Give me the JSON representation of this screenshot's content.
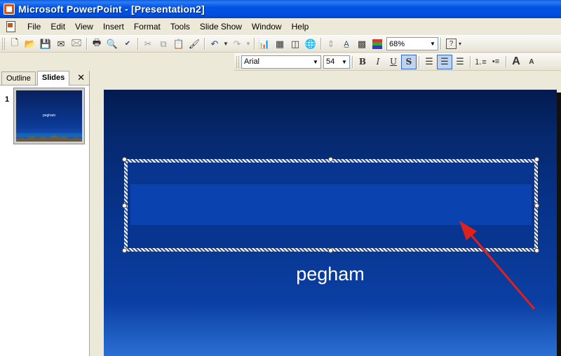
{
  "window": {
    "title": "Microsoft PowerPoint - [Presentation2]"
  },
  "menu": {
    "items": [
      {
        "label": "File"
      },
      {
        "label": "Edit"
      },
      {
        "label": "View"
      },
      {
        "label": "Insert"
      },
      {
        "label": "Format"
      },
      {
        "label": "Tools"
      },
      {
        "label": "Slide Show"
      },
      {
        "label": "Window"
      },
      {
        "label": "Help"
      }
    ]
  },
  "standard_toolbar": {
    "zoom": "68%"
  },
  "formatting_toolbar": {
    "font": "Arial",
    "size": "54",
    "bold": "B",
    "italic": "I",
    "underline": "U",
    "shadow": "S"
  },
  "pane": {
    "tabs": [
      {
        "label": "Outline"
      },
      {
        "label": "Slides"
      }
    ],
    "close": "✕",
    "slide_number": "1",
    "thumb_text": "pegham"
  },
  "slide": {
    "subtitle": "pegham"
  },
  "colors": {
    "title_bar": "#0050e0",
    "slide_bg": "#07338a",
    "arrow": "#e0201b"
  }
}
